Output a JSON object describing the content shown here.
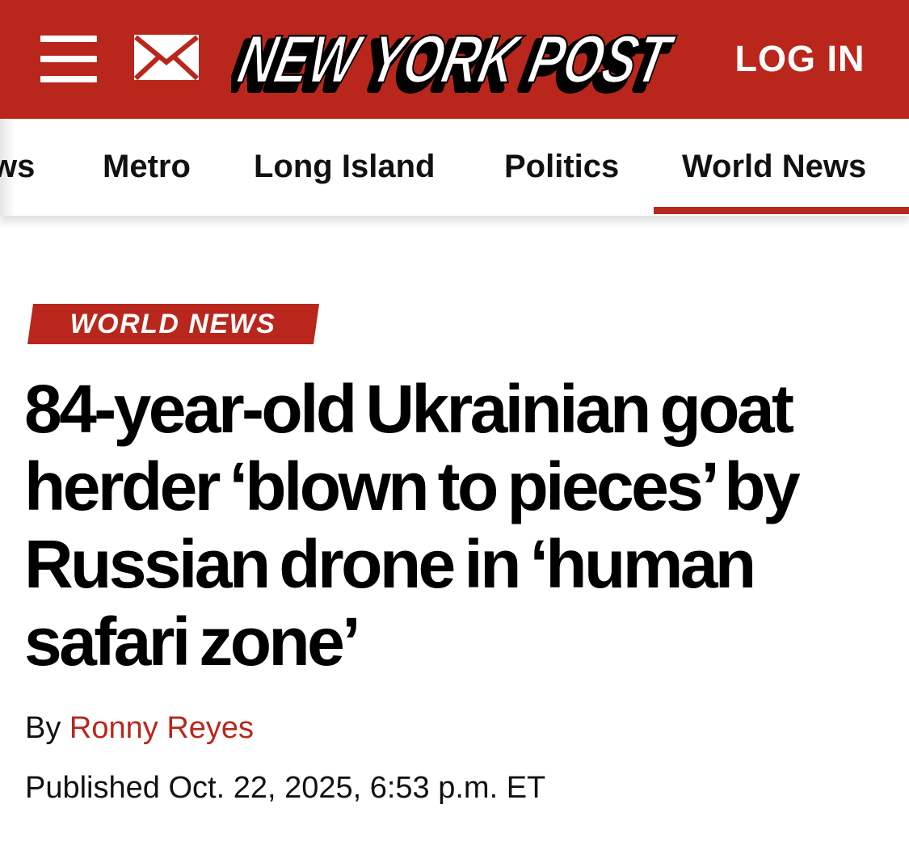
{
  "header": {
    "logo_text": "NEW YORK POST",
    "login_label": "LOG IN",
    "menu_icon": "hamburger-menu-icon",
    "mail_icon": "envelope-icon",
    "brand_color": "#B9271C"
  },
  "nav": {
    "items": [
      {
        "label": "ws"
      },
      {
        "label": "Metro"
      },
      {
        "label": "Long Island"
      },
      {
        "label": "Politics"
      },
      {
        "label": "World News"
      }
    ],
    "active_label": "World News"
  },
  "article": {
    "section_badge": "WORLD NEWS",
    "headline": "84-year-old Ukrainian goat herder ‘blown to pieces’ by Russian drone in ‘human safari zone’",
    "byline_prefix": "By",
    "author": "Ronny Reyes",
    "published": "Published Oct. 22, 2025, 6:53 p.m. ET"
  }
}
